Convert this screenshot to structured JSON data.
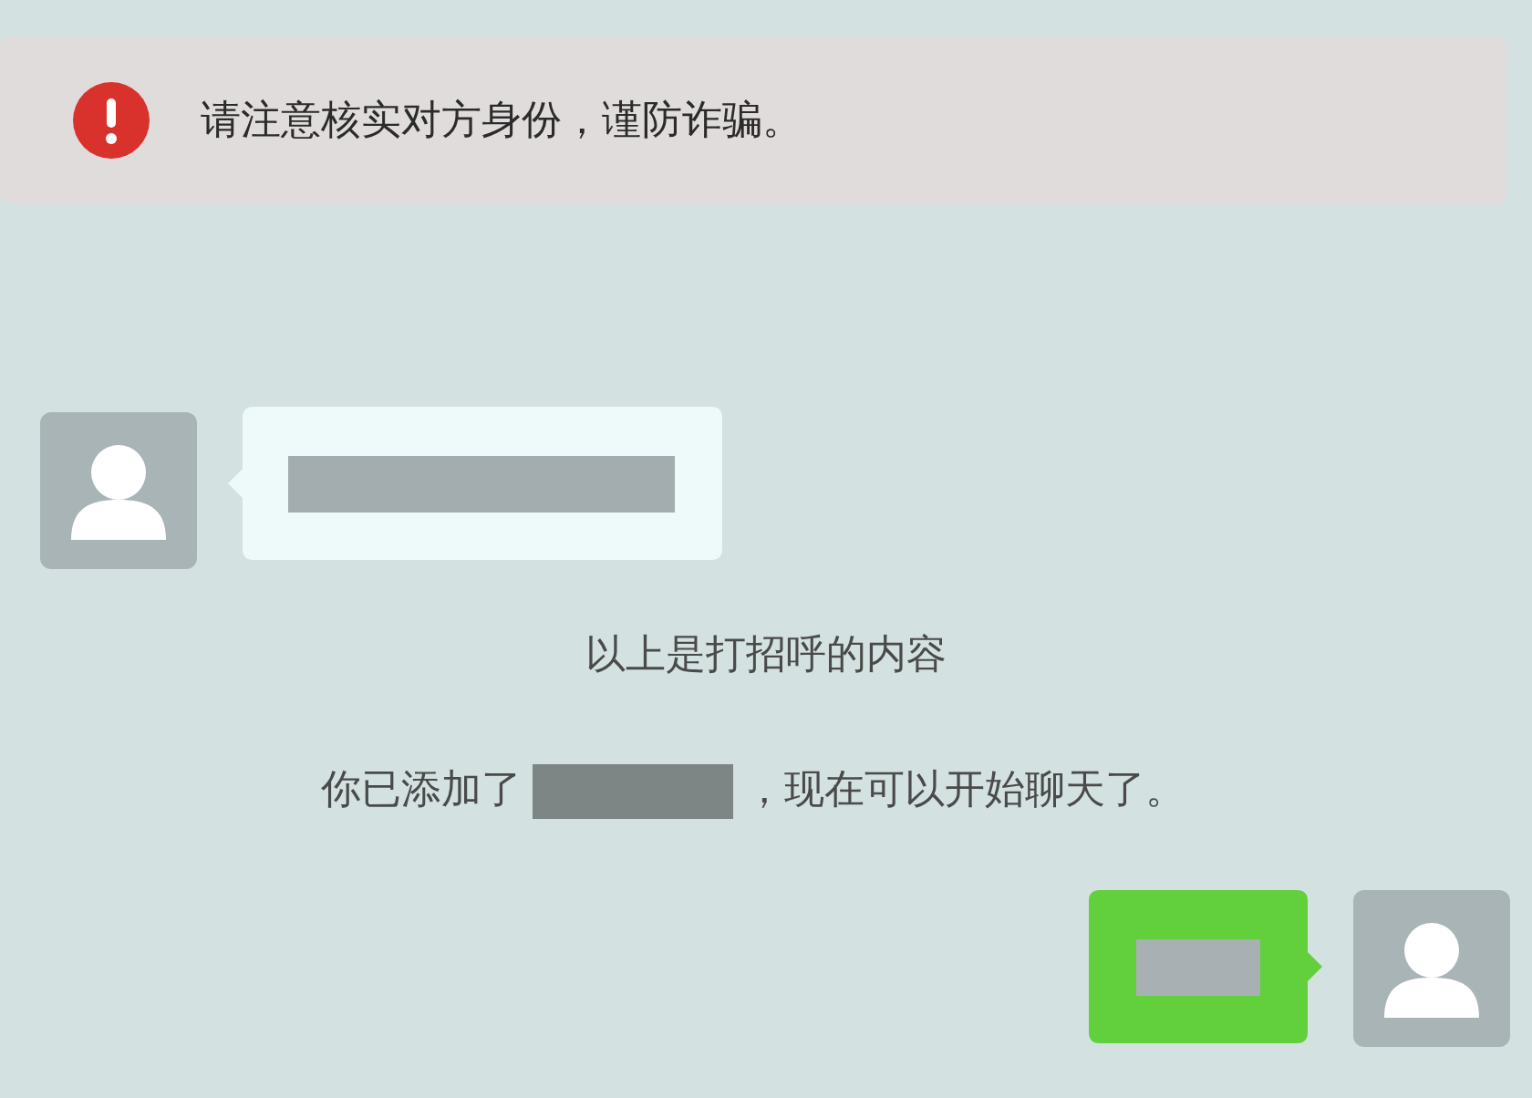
{
  "warning_banner": {
    "text": "请注意核实对方身份，谨防诈骗。"
  },
  "messages": [
    {
      "kind": "incoming_bubble"
    },
    {
      "kind": "note",
      "text": "以上是打招呼的内容"
    },
    {
      "kind": "added_note",
      "before": "你已添加了",
      "after": "，现在可以开始聊天了。"
    },
    {
      "kind": "outgoing_bubble"
    }
  ]
}
